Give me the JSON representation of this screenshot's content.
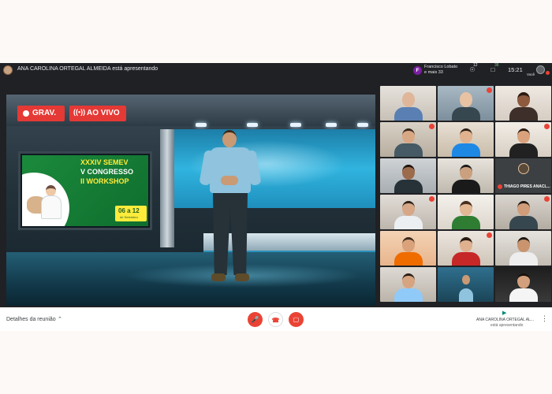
{
  "topbar": {
    "presenter_text": "ANA CAROLINA ORTEGAL ALMEIDA está apresentando",
    "participant_chip_initial": "F",
    "participant_chip_line1": "Francisco Lobato",
    "participant_chip_line2": "e mais 33",
    "people_count": "12",
    "chat_badge": "36",
    "clock": "15:21",
    "self_label": "Você"
  },
  "stage": {
    "rec_label": "GRAV.",
    "live_label": "AO VIVO",
    "tv": {
      "line1": "XXXIV SEMEV",
      "line2": "V CONGRESSO",
      "line3": "II WORKSHOP",
      "date_main": "06 a 12",
      "date_sub": "de Setembro"
    }
  },
  "tiles": {
    "thiago_name": "THIAGO PIRES ANACL..."
  },
  "bottombar": {
    "details_label": "Detalhes da reunião",
    "presenting_name": "ANA CAROLINA ORTEGAL AL...",
    "presenting_sub": "está apresentando"
  },
  "colors": {
    "accent_red": "#ea4335",
    "dark_bg": "#202124",
    "rec_red": "#e53935"
  },
  "icons": {
    "caret": "chevron-up-icon",
    "mic": "mic-off-icon",
    "hangup": "hangup-icon",
    "camera": "camera-off-icon",
    "more": "more-vert-icon"
  }
}
